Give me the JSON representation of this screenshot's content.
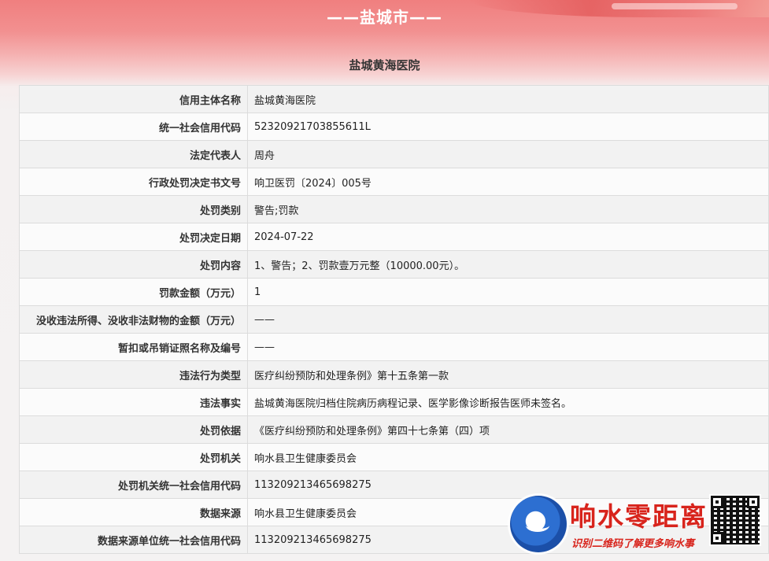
{
  "header": {
    "city_title": "——盐城市——",
    "org_title": "盐城黄海医院"
  },
  "record": [
    {
      "label": "信用主体名称",
      "value": "盐城黄海医院"
    },
    {
      "label": "统一社会信用代码",
      "value": "52320921703855611L"
    },
    {
      "label": "法定代表人",
      "value": "周舟"
    },
    {
      "label": "行政处罚决定书文号",
      "value": "响卫医罚〔2024〕005号"
    },
    {
      "label": "处罚类别",
      "value": "警告;罚款"
    },
    {
      "label": "处罚决定日期",
      "value": "2024-07-22"
    },
    {
      "label": "处罚内容",
      "value": "1、警告；2、罚款壹万元整（10000.00元）。"
    },
    {
      "label": "罚款金额（万元）",
      "value": "1"
    },
    {
      "label": "没收违法所得、没收非法财物的金额（万元）",
      "value": "——"
    },
    {
      "label": "暂扣或吊销证照名称及编号",
      "value": "——"
    },
    {
      "label": "违法行为类型",
      "value": "医疗纠纷预防和处理条例》第十五条第一款"
    },
    {
      "label": "违法事实",
      "value": "盐城黄海医院归档住院病历病程记录、医学影像诊断报告医师未签名。"
    },
    {
      "label": "处罚依据",
      "value": "《医疗纠纷预防和处理条例》第四十七条第（四）项"
    },
    {
      "label": "处罚机关",
      "value": "响水县卫生健康委员会"
    },
    {
      "label": "处罚机关统一社会信用代码",
      "value": "113209213465698275"
    },
    {
      "label": "数据来源",
      "value": "响水县卫生健康委员会"
    },
    {
      "label": "数据来源单位统一社会信用代码",
      "value": "113209213465698275"
    }
  ],
  "watermark": {
    "name": "响水零距离",
    "subtitle": "识别二维码了解更多响水事",
    "brand_color": "#d8241c"
  }
}
